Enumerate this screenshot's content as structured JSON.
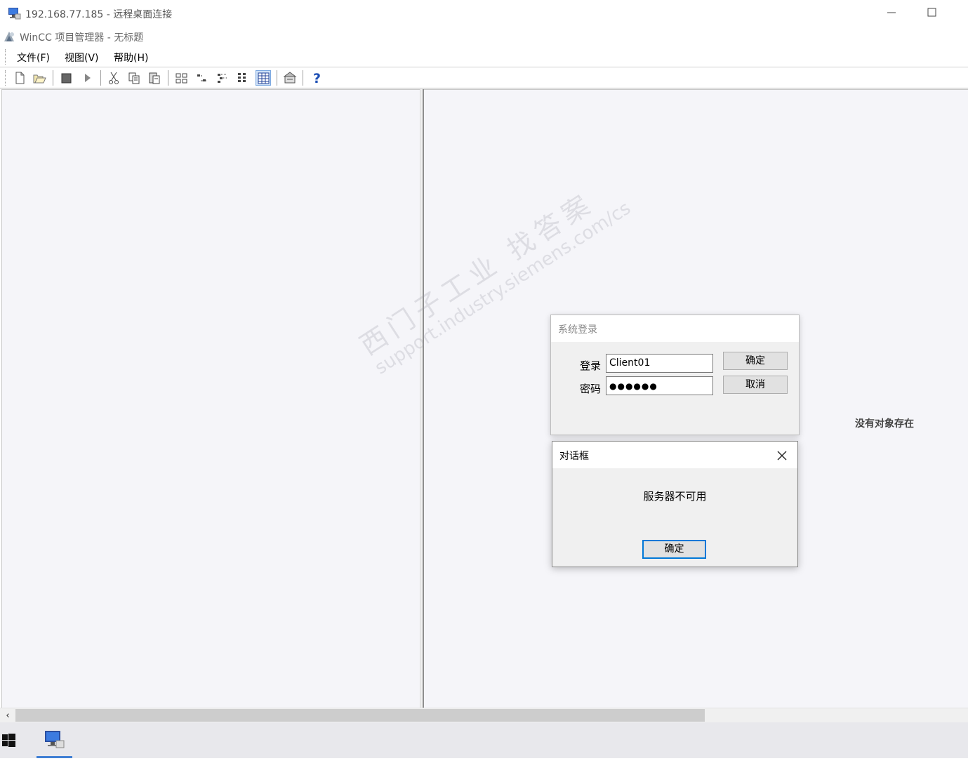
{
  "rdp": {
    "title": "192.168.77.185 - 远程桌面连接",
    "icon": "remote-desktop-icon"
  },
  "app": {
    "title": "WinCC 项目管理器 - 无标题",
    "icon": "wincc-icon"
  },
  "menu": [
    {
      "label": "文件(F)"
    },
    {
      "label": "视图(V)"
    },
    {
      "label": "帮助(H)"
    }
  ],
  "toolbar": {
    "buttons": [
      "new-icon",
      "open-icon",
      "stop-icon",
      "run-icon",
      "cut-icon",
      "copy-icon",
      "paste-icon",
      "large-icons-icon",
      "small-icons-icon",
      "list-icon",
      "details-icon",
      "table-view-icon",
      "properties-icon",
      "help-icon"
    ],
    "active": "table-view-icon"
  },
  "right_pane": {
    "empty_text": "没有对象存在"
  },
  "login_dialog": {
    "title": "系统登录",
    "login_label": "登录",
    "login_value": "Client01",
    "password_label": "密码",
    "password_value": "●●●●●●",
    "ok_label": "确定",
    "cancel_label": "取消"
  },
  "message_dialog": {
    "title": "对话框",
    "message": "服务器不可用",
    "ok_label": "确定"
  },
  "watermark": {
    "line1": "西门子工业  找答案",
    "line2": "support.industry.siemens.com/cs"
  }
}
